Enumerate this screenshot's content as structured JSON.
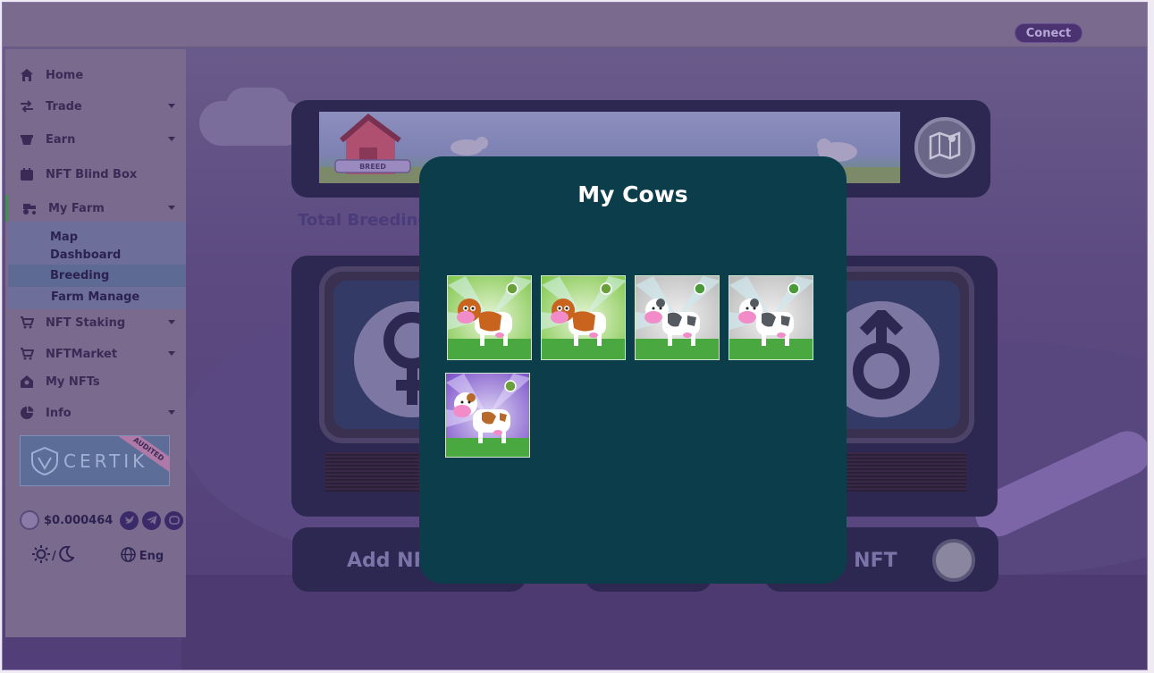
{
  "header": {
    "connect_label": "Conect"
  },
  "sidebar": {
    "items": [
      {
        "label": "Home",
        "icon": "home-icon"
      },
      {
        "label": "Trade",
        "icon": "swap-icon",
        "expandable": true
      },
      {
        "label": "Earn",
        "icon": "pot-icon",
        "expandable": true
      },
      {
        "label": "NFT Blind Box",
        "icon": "box-icon"
      },
      {
        "label": "My Farm",
        "icon": "tractor-icon",
        "expandable": true,
        "expanded": true
      },
      {
        "label": "NFT Staking",
        "icon": "cart-icon",
        "expandable": true
      },
      {
        "label": "NFTMarket",
        "icon": "cart-icon",
        "expandable": true
      },
      {
        "label": "My NFTs",
        "icon": "user-icon"
      },
      {
        "label": "Info",
        "icon": "pie-chart-icon",
        "expandable": true
      }
    ],
    "farm_submenu": [
      {
        "label": "Map"
      },
      {
        "label": "Dashboard"
      },
      {
        "label": "Breeding",
        "active": true
      },
      {
        "label": "Farm Manage"
      }
    ],
    "certik": {
      "label": "CERTIK",
      "badge": "AUDITED"
    },
    "price": "$0.000464",
    "socials": [
      "twitter-icon",
      "telegram-icon",
      "discord-icon"
    ],
    "theme_separator": "/",
    "language": "Eng"
  },
  "main": {
    "banner": {
      "breed_sign": "BREED"
    },
    "total_breeding_label": "Total Breeding",
    "add_nft_left": "Add NFT",
    "add_nft_right": "Add NFT"
  },
  "modal": {
    "title": "My Cows",
    "cows": [
      {
        "color": "brown",
        "background": "green"
      },
      {
        "color": "brown",
        "background": "green"
      },
      {
        "color": "grey",
        "background": "grey"
      },
      {
        "color": "grey",
        "background": "grey"
      },
      {
        "color": "brown",
        "background": "purple"
      }
    ]
  },
  "colors": {
    "modal_bg": "#0b3d4b",
    "overlay": "#6b5e8c",
    "connect_bg": "#4a3370"
  }
}
